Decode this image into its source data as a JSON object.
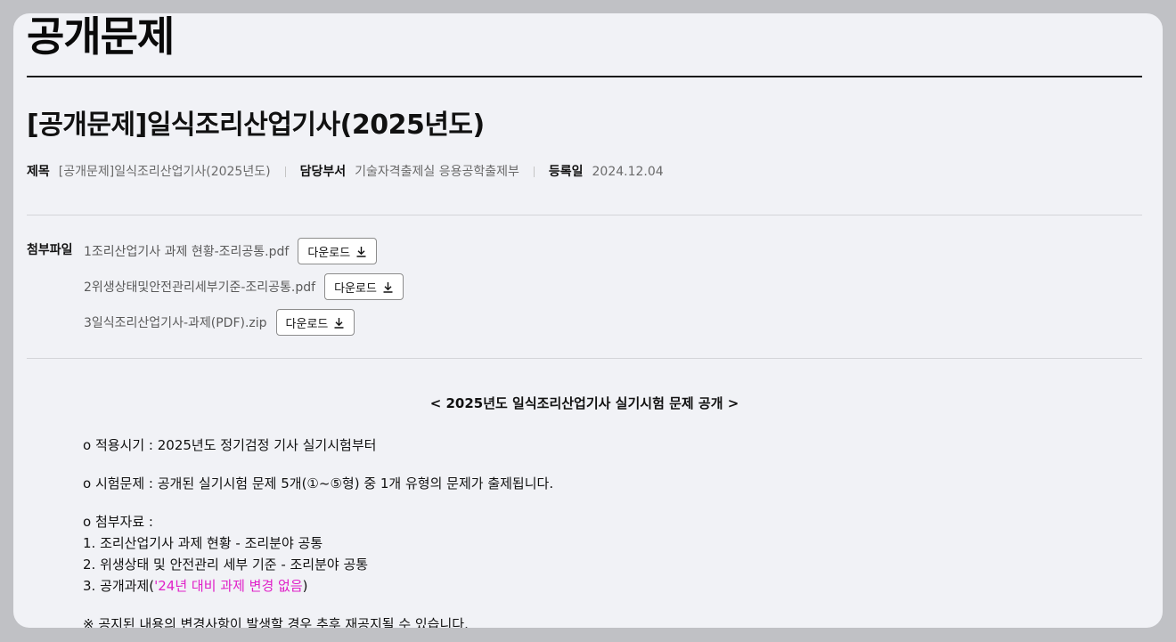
{
  "page_title": "공개문제",
  "post": {
    "title": "[공개문제]일식조리산업기사(2025년도)",
    "meta": {
      "subject_label": "제목",
      "subject_value": "[공개문제]일식조리산업기사(2025년도)",
      "dept_label": "담당부서",
      "dept_value": "기술자격출제실 응용공학출제부",
      "date_label": "등록일",
      "date_value": "2024.12.04"
    }
  },
  "attachments": {
    "label": "첨부파일",
    "download_label": "다운로드",
    "files": [
      {
        "name": "1조리산업기사 과제 현황-조리공통.pdf"
      },
      {
        "name": "2위생상태및안전관리세부기준-조리공통.pdf"
      },
      {
        "name": "3일식조리산업기사-과제(PDF).zip"
      }
    ]
  },
  "content": {
    "heading": "< 2025년도 일식조리산업기사 실기시험 문제 공개 >",
    "apply": "o 적용시기 : 2025년도 정기검정 기사 실기시험부터",
    "exam": "o 시험문제 : 공개된 실기시험 문제 5개(①~⑤형) 중 1개 유형의 문제가 출제됩니다.",
    "ref_title": "o 첨부자료 :",
    "ref1": "1. 조리산업기사 과제 현황 - 조리분야 공통",
    "ref2": "2. 위생상태 및 안전관리 세부 기준 - 조리분야 공통",
    "ref3_prefix": "3. 공개과제(",
    "ref3_highlight": "'24년 대비 과제 변경 없음",
    "ref3_suffix": ")",
    "notice": "※ 공지된 내용의 변경사항이 발생할 경우 추후 재공지될 수 있습니다."
  },
  "colors": {
    "background": "#c0c1c5",
    "card": "#f1f2f6",
    "highlight": "#e020c8"
  }
}
